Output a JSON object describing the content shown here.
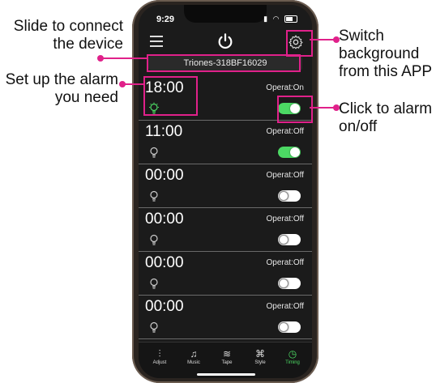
{
  "annotations": {
    "slide_connect": "Slide to connect\nthe device",
    "set_alarm": "Set up the alarm\nyou need",
    "switch_bg": "Switch\nbackground\nfrom this APP",
    "click_alarm": "Click to alarm\non/off"
  },
  "status_bar": {
    "time": "9:29"
  },
  "device": {
    "name": "Triones-318BF16029"
  },
  "alarms": [
    {
      "time": "18:00",
      "status": "Operat:On",
      "enabled": true
    },
    {
      "time": "11:00",
      "status": "Operat:Off",
      "enabled": true
    },
    {
      "time": "00:00",
      "status": "Operat:Off",
      "enabled": false
    },
    {
      "time": "00:00",
      "status": "Operat:Off",
      "enabled": false
    },
    {
      "time": "00:00",
      "status": "Operat:Off",
      "enabled": false
    },
    {
      "time": "00:00",
      "status": "Operat:Off",
      "enabled": false
    }
  ],
  "tabs": [
    {
      "label": "Adjust",
      "icon": "sliders-icon",
      "glyph": "⫶",
      "active": false
    },
    {
      "label": "Music",
      "icon": "music-note-icon",
      "glyph": "♫",
      "active": false
    },
    {
      "label": "Tape",
      "icon": "wave-icon",
      "glyph": "≋",
      "active": false
    },
    {
      "label": "Style",
      "icon": "command-icon",
      "glyph": "⌘",
      "active": false
    },
    {
      "label": "Timing",
      "icon": "clock-icon",
      "glyph": "◷",
      "active": true
    }
  ],
  "colors": {
    "accent": "#e0218a",
    "toggle_on": "#4cd964",
    "active_tab": "#4cd964",
    "bulb_active": "#4cd964"
  }
}
